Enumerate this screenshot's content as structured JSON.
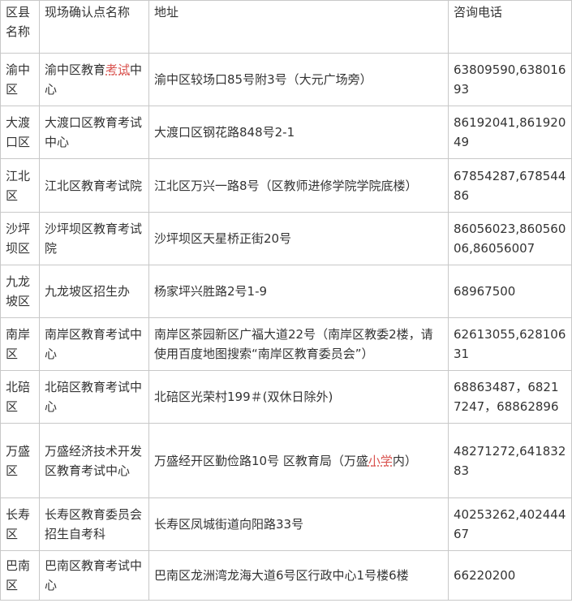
{
  "header": {
    "district": "区县名称",
    "site": "现场确认点名称",
    "address": "地址",
    "phone": "咨询电话"
  },
  "rows": [
    {
      "district": "渝中区",
      "site_a": "渝中区教育",
      "site_hl": "考试",
      "site_b": "中心",
      "address_a": "渝中区较场口85号附3号（大元广场旁）",
      "address_hl": "",
      "address_b": "",
      "phone": "63809590,63801693"
    },
    {
      "district": "大渡口区",
      "site_a": "大渡口区教育考试中心",
      "site_hl": "",
      "site_b": "",
      "address_a": "大渡口区钢花路848号2-1",
      "address_hl": "",
      "address_b": "",
      "phone": "86192041,86192049"
    },
    {
      "district": "江北区",
      "site_a": "江北区教育考试院",
      "site_hl": "",
      "site_b": "",
      "address_a": "江北区万兴一路8号（区教师进修学院学院底楼）",
      "address_hl": "",
      "address_b": "",
      "phone": "67854287,67854486"
    },
    {
      "district": "沙坪坝区",
      "site_a": "沙坪坝区教育考试院",
      "site_hl": "",
      "site_b": "",
      "address_a": "沙坪坝区天星桥正街20号",
      "address_hl": "",
      "address_b": "",
      "phone": "86056023,86056006,86056007"
    },
    {
      "district": "九龙坡区",
      "site_a": "九龙坡区招生办",
      "site_hl": "",
      "site_b": "",
      "address_a": "杨家坪兴胜路2号1-9",
      "address_hl": "",
      "address_b": "",
      "phone": "68967500"
    },
    {
      "district": "南岸区",
      "site_a": "南岸区教育考试中心",
      "site_hl": "",
      "site_b": "",
      "address_a": "南岸区茶园新区广福大道22号（南岸区教委2楼，请使用百度地图搜索“南岸区教育委员会”）",
      "address_hl": "",
      "address_b": "",
      "phone": "62613055,62810631"
    },
    {
      "district": "北碚区",
      "site_a": "北碚区教育考试中心",
      "site_hl": "",
      "site_b": "",
      "address_a": "北碚区光荣村199＃(双休日除外)",
      "address_hl": "",
      "address_b": "",
      "phone": "68863487，68217247，68862896"
    },
    {
      "district": "万盛区",
      "site_a": "万盛经济技术开发区教育考试中心",
      "site_hl": "",
      "site_b": "",
      "address_a": "万盛经开区勤俭路10号 区教育局（万盛",
      "address_hl": "小学",
      "address_b": "内）",
      "phone": "48271272,64183283"
    },
    {
      "district": "长寿区",
      "site_a": "长寿区教育委员会招生自考科",
      "site_hl": "",
      "site_b": "",
      "address_a": "长寿区凤城街道向阳路33号",
      "address_hl": "",
      "address_b": "",
      "phone": "40253262,40244467"
    },
    {
      "district": "巴南区",
      "site_a": "巴南区教育考试中心",
      "site_hl": "",
      "site_b": "",
      "address_a": "巴南区龙洲湾龙海大道6号区行政中心1号楼6楼",
      "address_hl": "",
      "address_b": "",
      "phone": "66220200"
    }
  ]
}
